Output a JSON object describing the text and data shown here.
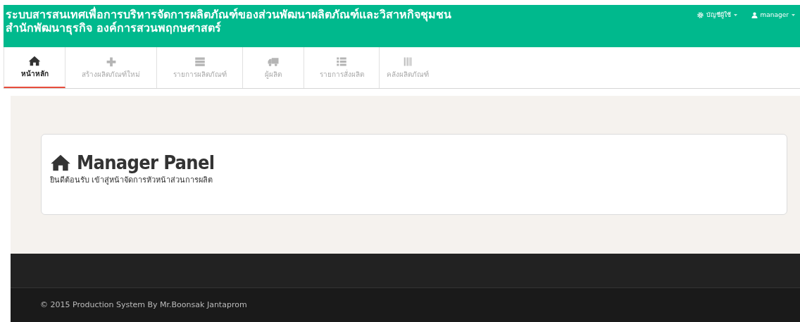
{
  "header": {
    "title_lines": [
      "ระบบสารสนเทศเพื่อการบริหารจัดการผลิตภัณฑ์ของส่วนพัฒนาผลิตภัณฑ์และวิสาหกิจชุมชน",
      "สำนักพัฒนาธุรกิจ องค์การสวนพฤกษศาสตร์"
    ],
    "menus": [
      {
        "label": "บัญชีผู้ใช้"
      },
      {
        "label": "manager"
      }
    ]
  },
  "tabs": [
    {
      "label": "หน้าหลัก",
      "selected": true
    },
    {
      "label": "สร้างผลิตภัณฑ์ใหม่",
      "selected": false
    },
    {
      "label": "รายการผลิตภัณฑ์",
      "selected": false
    },
    {
      "label": "ผู้ผลิต",
      "selected": false
    },
    {
      "label": "รายการสั่งผลิต",
      "selected": false
    },
    {
      "label": "คลังผลิตภัณฑ์",
      "selected": false
    }
  ],
  "panel": {
    "title": "Manager Panel",
    "subtitle": "ยินดีต้อนรับ เข้าสู่หน้าจัดการหัวหน้าส่วนการผลิต"
  },
  "footer": {
    "text": "© 2015 Production System By Mr.Boonsak Jantaprom"
  }
}
